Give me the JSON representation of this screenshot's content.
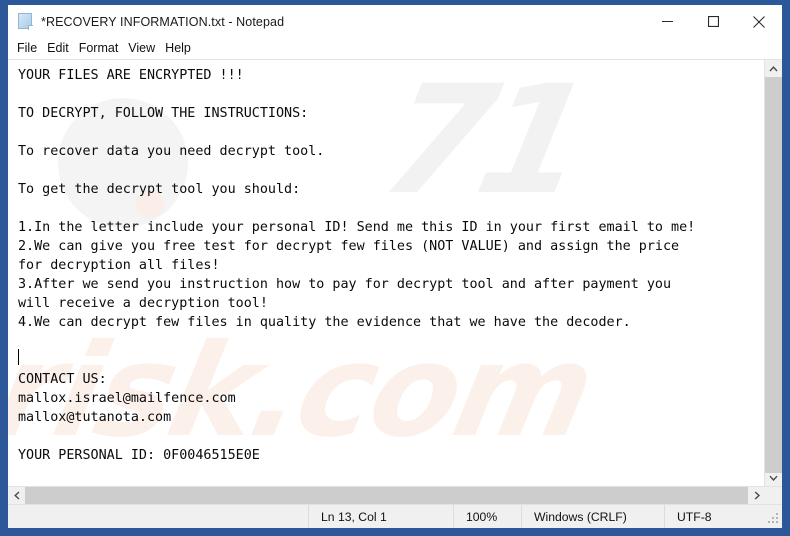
{
  "window": {
    "title": "*RECOVERY INFORMATION.txt - Notepad",
    "icon": "notepad-document-icon",
    "border_color": "#2c5899",
    "controls": {
      "minimize_label": "Minimize",
      "maximize_label": "Maximize",
      "close_label": "Close"
    }
  },
  "menubar": {
    "items": [
      {
        "label": "File"
      },
      {
        "label": "Edit"
      },
      {
        "label": "Format"
      },
      {
        "label": "View"
      },
      {
        "label": "Help"
      }
    ]
  },
  "editor": {
    "content": "YOUR FILES ARE ENCRYPTED !!!\n\nTO DECRYPT, FOLLOW THE INSTRUCTIONS:\n\nTo recover data you need decrypt tool.\n\nTo get the decrypt tool you should:\n\n1.In the letter include your personal ID! Send me this ID in your first email to me!\n2.We can give you free test for decrypt few files (NOT VALUE) and assign the price\nfor decryption all files!\n3.After we send you instruction how to pay for decrypt tool and after payment you\nwill receive a decryption tool!\n4.We can decrypt few files in quality the evidence that we have the decoder.\n\n\nCONTACT US:\nmallox.israel@mailfence.com\nmallox@tutanota.com\n\nYOUR PERSONAL ID: 0F0046515E0E",
    "lines": [
      "YOUR FILES ARE ENCRYPTED !!!",
      "",
      "TO DECRYPT, FOLLOW THE INSTRUCTIONS:",
      "",
      "To recover data you need decrypt tool.",
      "",
      "To get the decrypt tool you should:",
      "",
      "1.In the letter include your personal ID! Send me this ID in your first email to me!",
      "2.We can give you free test for decrypt few files (NOT VALUE) and assign the price",
      "for decryption all files!",
      "3.After we send you instruction how to pay for decrypt tool and after payment you",
      "will receive a decryption tool!",
      "4.We can decrypt few files in quality the evidence that we have the decoder.",
      "",
      "",
      "CONTACT US:",
      "mallox.israel@mailfence.com",
      "mallox@tutanota.com",
      "",
      "YOUR PERSONAL ID: 0F0046515E0E"
    ],
    "contacts": [
      "mallox.israel@mailfence.com",
      "mallox@tutanota.com"
    ],
    "personal_id": "0F0046515E0E",
    "text_color": "#0a0a0a"
  },
  "watermark": {
    "top_text": "71",
    "bottom_text": "risk.com",
    "top_color": "#f2f2f2",
    "bottom_color": "#fcf0ea"
  },
  "scrollbars": {
    "vertical": {
      "up_arrow": "chevron-up-icon",
      "down_arrow": "chevron-down-icon"
    },
    "horizontal": {
      "left_arrow": "chevron-left-icon",
      "right_arrow": "chevron-right-icon"
    },
    "thumb_color": "#cdcdcd"
  },
  "statusbar": {
    "position": "Ln 13, Col 1",
    "zoom": "100%",
    "line_ending": "Windows (CRLF)",
    "encoding": "UTF-8"
  }
}
